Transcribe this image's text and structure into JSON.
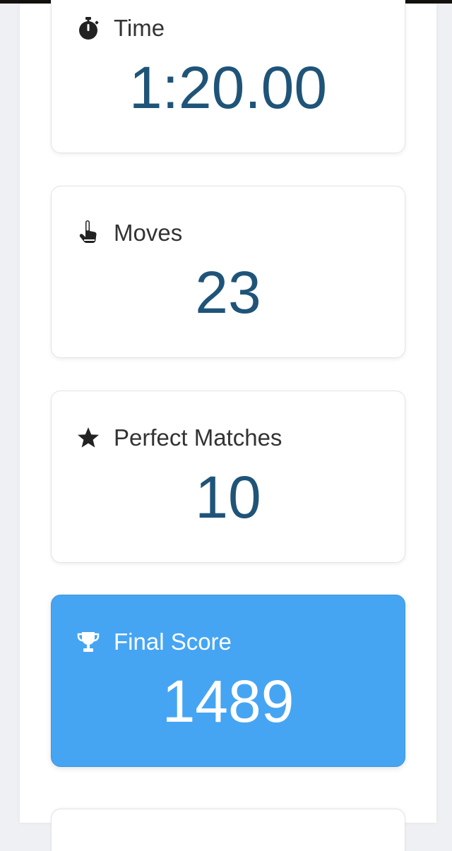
{
  "stats": {
    "time": {
      "label": "Time",
      "value": "1:20.00",
      "icon": "stopwatch-icon"
    },
    "moves": {
      "label": "Moves",
      "value": "23",
      "icon": "hand-pointer-icon"
    },
    "perfect_matches": {
      "label": "Perfect Matches",
      "value": "10",
      "icon": "star-icon"
    },
    "final_score": {
      "label": "Final Score",
      "value": "1489",
      "icon": "trophy-icon"
    }
  },
  "colors": {
    "value_text": "#1f5478",
    "label_text": "#333333",
    "highlight_card": "#45a5f3",
    "page_background": "#eef0f4"
  }
}
